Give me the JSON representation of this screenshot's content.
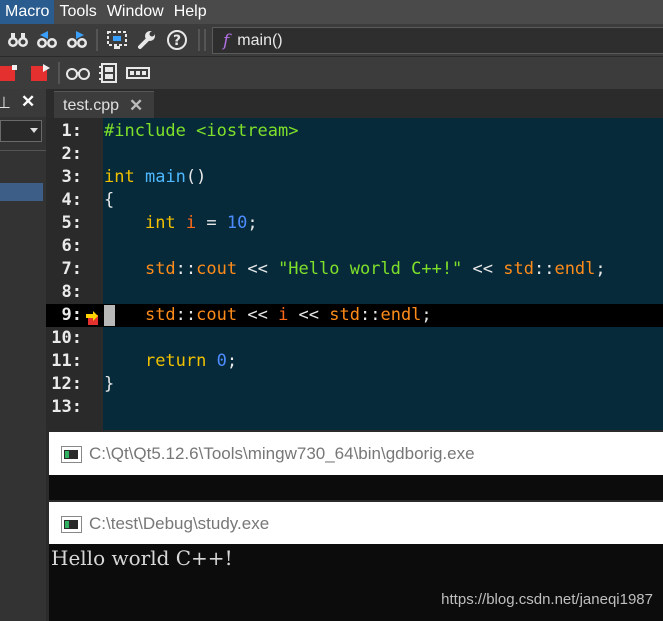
{
  "menubar": {
    "items": [
      "Macro",
      "Tools",
      "Window",
      "Help"
    ]
  },
  "toolbar": {
    "icons": [
      "binoculars-icon",
      "binoculars-prev-icon",
      "binoculars-next-icon",
      "screen-select-icon",
      "wrench-icon",
      "help-icon"
    ],
    "function_symbol": "f",
    "current_function": "main()"
  },
  "toolbar2": {
    "icons": [
      "bookmark-red-icon",
      "bookmark-next-icon",
      "glasses-icon",
      "film-icon",
      "registers-icon"
    ]
  },
  "left_panel": {
    "pin_glyph": "⊥",
    "close_glyph": "✕"
  },
  "editor": {
    "tab_label": "test.cpp",
    "tab_close": "✕",
    "current_line": 9,
    "lines": [
      {
        "n": "1:",
        "tokens": [
          [
            "pp",
            "#include <iostream>"
          ]
        ]
      },
      {
        "n": "2:",
        "tokens": []
      },
      {
        "n": "3:",
        "tokens": [
          [
            "kw",
            "int"
          ],
          [
            "op",
            " "
          ],
          [
            "fn",
            "main"
          ],
          [
            "op",
            "()"
          ]
        ]
      },
      {
        "n": "4:",
        "tokens": [
          [
            "op",
            "{"
          ]
        ]
      },
      {
        "n": "5:",
        "tokens": [
          [
            "op",
            "    "
          ],
          [
            "kw",
            "int"
          ],
          [
            "op",
            " "
          ],
          [
            "vr",
            "i"
          ],
          [
            "op",
            " = "
          ],
          [
            "nm",
            "10"
          ],
          [
            "op",
            ";"
          ]
        ]
      },
      {
        "n": "6:",
        "tokens": []
      },
      {
        "n": "7:",
        "tokens": [
          [
            "op",
            "    "
          ],
          [
            "ns",
            "std"
          ],
          [
            "op",
            "::"
          ],
          [
            "ns",
            "cout"
          ],
          [
            "op",
            " << "
          ],
          [
            "st",
            "\"Hello world C++!\""
          ],
          [
            "op",
            " << "
          ],
          [
            "ns",
            "std"
          ],
          [
            "op",
            "::"
          ],
          [
            "ns",
            "endl"
          ],
          [
            "op",
            ";"
          ]
        ]
      },
      {
        "n": "8:",
        "tokens": []
      },
      {
        "n": "9:",
        "tokens": [
          [
            "op",
            "    "
          ],
          [
            "ns",
            "std"
          ],
          [
            "op",
            "::"
          ],
          [
            "ns",
            "cout"
          ],
          [
            "op",
            " << "
          ],
          [
            "vr",
            "i"
          ],
          [
            "op",
            " << "
          ],
          [
            "ns",
            "std"
          ],
          [
            "op",
            "::"
          ],
          [
            "ns",
            "endl"
          ],
          [
            "op",
            ";"
          ]
        ]
      },
      {
        "n": "10:",
        "tokens": []
      },
      {
        "n": "11:",
        "tokens": [
          [
            "op",
            "    "
          ],
          [
            "kw",
            "return"
          ],
          [
            "op",
            " "
          ],
          [
            "nm",
            "0"
          ],
          [
            "op",
            ";"
          ]
        ]
      },
      {
        "n": "12:",
        "tokens": [
          [
            "op",
            "}"
          ]
        ]
      },
      {
        "n": "13:",
        "tokens": []
      }
    ]
  },
  "console1": {
    "title": "C:\\Qt\\Qt5.12.6\\Tools\\mingw730_64\\bin\\gdborig.exe"
  },
  "console2": {
    "title": "C:\\test\\Debug\\study.exe",
    "output": "Hello world C++!",
    "watermark": "https://blog.csdn.net/janeqi1987"
  },
  "colors": {
    "editor_bg": "#062a3a",
    "keyword": "#f0c000",
    "string": "#7fe02a",
    "namespace": "#ff8c1a",
    "number": "#4d8cff",
    "function": "#4db8ff"
  }
}
